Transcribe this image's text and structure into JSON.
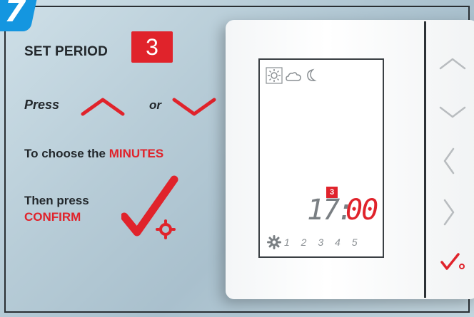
{
  "step": {
    "number": "7"
  },
  "instructions": {
    "set_period_label": "SET PERIOD",
    "period_value": "3",
    "press_label": "Press",
    "or_label": "or",
    "choose_prefix": "To choose the ",
    "choose_highlight": "MINUTES",
    "then_press_label": "Then press",
    "confirm_label": "CONFIRM"
  },
  "display": {
    "mode_icons": [
      "sun-icon",
      "cloud-icon",
      "moon-icon"
    ],
    "period_badge": "3",
    "time_hours": "17",
    "time_separator": ":",
    "time_minutes": "00",
    "days": "1 2 3 4 5"
  },
  "buttons": [
    "up-button",
    "down-button",
    "left-button",
    "right-button",
    "confirm-button"
  ],
  "colors": {
    "accent": "#e0232b",
    "step_badge": "#1496e0",
    "text": "#22272b"
  }
}
